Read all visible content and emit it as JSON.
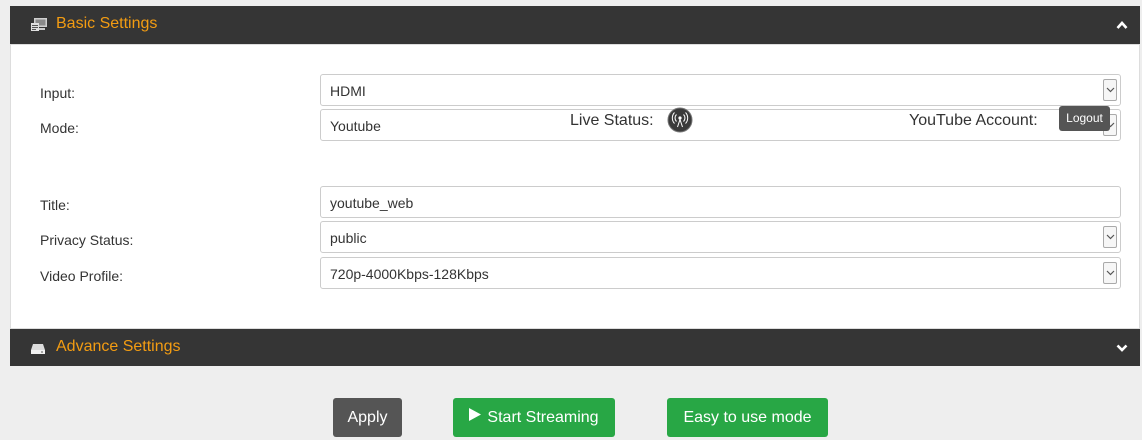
{
  "basic": {
    "title": "Basic Settings",
    "icon": "monitor-settings-icon",
    "rows": {
      "input": {
        "label": "Input:",
        "value": "HDMI"
      },
      "mode": {
        "label": "Mode:",
        "value": "Youtube"
      },
      "title": {
        "label": "Title:",
        "value": "youtube_web"
      },
      "privacy": {
        "label": "Privacy Status:",
        "value": "public"
      },
      "profile": {
        "label": "Video Profile:",
        "value": "720p-4000Kbps-128Kbps"
      }
    },
    "live_status_label": "Live Status:",
    "youtube_account_label": "YouTube Account:",
    "logout_label": "Logout"
  },
  "advance": {
    "title": "Advance Settings",
    "icon": "drive-icon"
  },
  "actions": {
    "apply_label": "Apply",
    "start_label": "Start Streaming",
    "easy_label": "Easy to use mode"
  },
  "colors": {
    "header_bg": "#353535",
    "header_text": "#f39c12",
    "green": "#28a745",
    "dark_button": "#555555"
  }
}
